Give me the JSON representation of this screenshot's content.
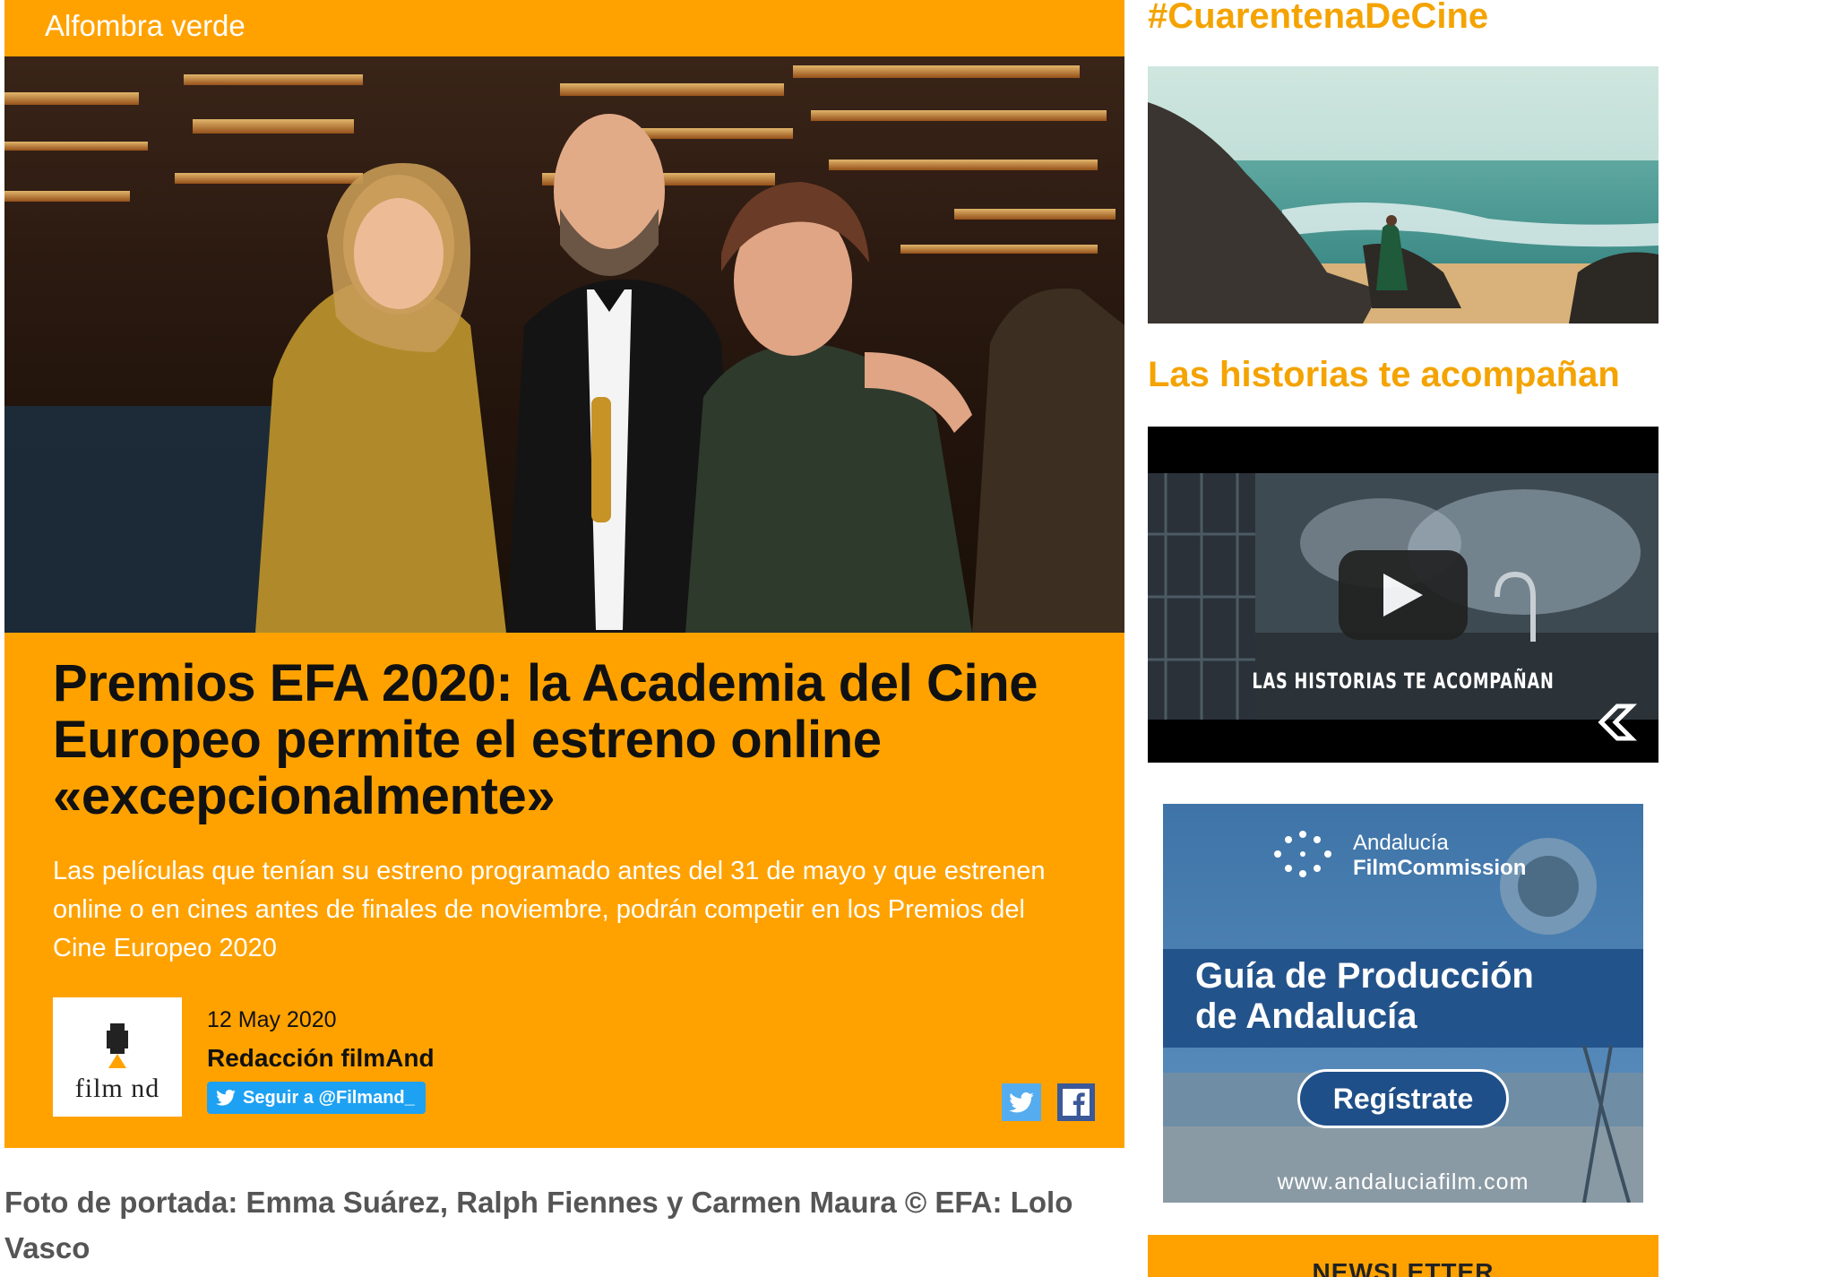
{
  "article": {
    "category": "Alfombra verde",
    "headline": "Premios EFA 2020: la Academia del Cine Europeo permite el estreno online «excepcionalmente»",
    "lede": "Las películas que tenían su estreno programado antes del 31 de mayo y que estrenen online o en cines antes de finales de noviembre, podrán competir en los Premios del Cine Europeo 2020",
    "author": {
      "logo_text": "film nd",
      "date": "12 May 2020",
      "name": "Redacción filmAnd",
      "follow_label": "Seguir a @Filmand_"
    },
    "share": {
      "twitter_icon": "twitter-icon",
      "facebook_icon": "facebook-icon"
    },
    "caption": "Foto de portada: Emma Suárez, Ralph Fiennes y Carmen Maura © EFA: Lolo Vasco"
  },
  "sidebar": {
    "hashtag_title": "#CuarentenaDeCine",
    "stories_title": "Las historias te acompañan",
    "video": {
      "overlay_text": "LAS HISTORIAS TE ACOMPAÑAN",
      "play_icon": "play-icon"
    },
    "ad": {
      "brand_line1": "Andalucía",
      "brand_line2": "FilmCommission",
      "heading_line1": "Guía de Producción",
      "heading_line2": "de Andalucía",
      "button_label": "Regístrate",
      "url": "www.andaluciafilm.com"
    },
    "newsletter_title": "NEWSLETTER"
  },
  "colors": {
    "accent": "#ffa200",
    "title_orange": "#f4a300",
    "twitter_blue": "#1da1f2",
    "facebook_blue": "#3b5998"
  }
}
